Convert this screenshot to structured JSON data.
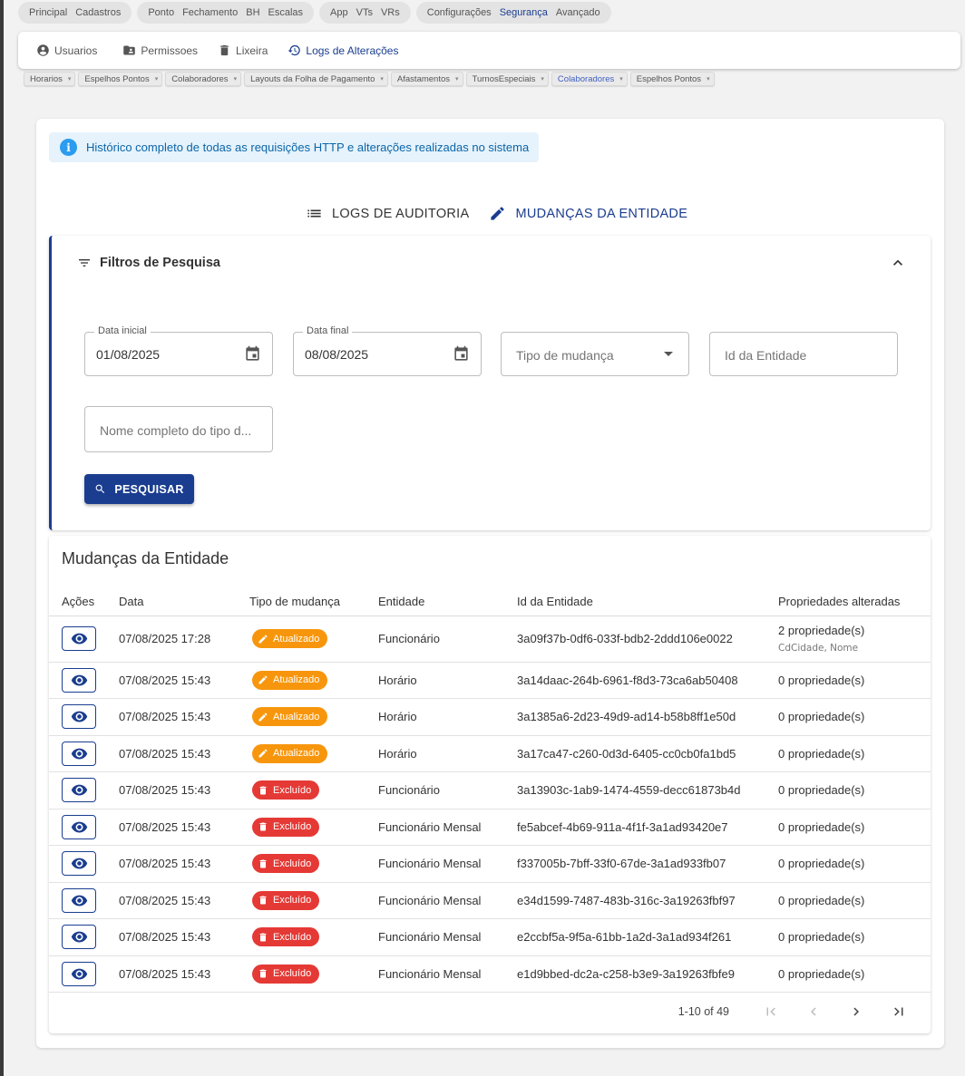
{
  "top_menu": [
    {
      "items": [
        {
          "label": "Principal",
          "active": false
        },
        {
          "label": "Cadastros",
          "active": false
        }
      ]
    },
    {
      "items": [
        {
          "label": "Ponto",
          "active": false
        },
        {
          "label": "Fechamento",
          "active": false
        },
        {
          "label": "BH",
          "active": false
        },
        {
          "label": "Escalas",
          "active": false
        }
      ]
    },
    {
      "items": [
        {
          "label": "App",
          "active": false
        },
        {
          "label": "VTs",
          "active": false
        },
        {
          "label": "VRs",
          "active": false
        }
      ]
    },
    {
      "items": [
        {
          "label": "Configurações",
          "active": false
        },
        {
          "label": "Segurança",
          "active": true
        },
        {
          "label": "Avançado",
          "active": false
        }
      ]
    }
  ],
  "subnav": {
    "usuarios": "Usuarios",
    "permissoes": "Permissoes",
    "lixeira": "Lixeira",
    "logs": "Logs de Alterações"
  },
  "open_tabs": [
    {
      "label": "Horarios",
      "active": false
    },
    {
      "label": "Espelhos Pontos",
      "active": false
    },
    {
      "label": "Colaboradores",
      "active": false
    },
    {
      "label": "Layouts da Folha de Pagamento",
      "active": false
    },
    {
      "label": "Afastamentos",
      "active": false
    },
    {
      "label": "TurnosEspeciais",
      "active": false
    },
    {
      "label": "Colaboradores",
      "active": true
    },
    {
      "label": "Espelhos Pontos",
      "active": false
    }
  ],
  "info_text": "Histórico completo de todas as requisições HTTP e alterações realizadas no sistema",
  "tabs": {
    "audit": "LOGS DE AUDITORIA",
    "entity": "MUDANÇAS DA ENTIDADE"
  },
  "filters": {
    "title": "Filtros de Pesquisa",
    "date_start_label": "Data inicial",
    "date_start_value": "01/08/2025",
    "date_end_label": "Data final",
    "date_end_value": "08/08/2025",
    "change_type_placeholder": "Tipo de mudança",
    "entity_id_placeholder": "Id da Entidade",
    "type_name_placeholder": "Nome completo do tipo d...",
    "search_button": "PESQUISAR"
  },
  "table": {
    "title": "Mudanças da Entidade",
    "headers": [
      "Ações",
      "Data",
      "Tipo de mudança",
      "Entidade",
      "Id da Entidade",
      "Propriedades alteradas"
    ],
    "rows": [
      {
        "date": "07/08/2025 17:28",
        "type": "Atualizado",
        "kind": "upd",
        "entity": "Funcionário",
        "id": "3a09f37b-0df6-033f-bdb2-2ddd106e0022",
        "props": "2 propriedade(s)",
        "props_detail": "CdCidade, Nome"
      },
      {
        "date": "07/08/2025 15:43",
        "type": "Atualizado",
        "kind": "upd",
        "entity": "Horário",
        "id": "3a14daac-264b-6961-f8d3-73ca6ab50408",
        "props": "0 propriedade(s)",
        "props_detail": ""
      },
      {
        "date": "07/08/2025 15:43",
        "type": "Atualizado",
        "kind": "upd",
        "entity": "Horário",
        "id": "3a1385a6-2d23-49d9-ad14-b58b8ff1e50d",
        "props": "0 propriedade(s)",
        "props_detail": ""
      },
      {
        "date": "07/08/2025 15:43",
        "type": "Atualizado",
        "kind": "upd",
        "entity": "Horário",
        "id": "3a17ca47-c260-0d3d-6405-cc0cb0fa1bd5",
        "props": "0 propriedade(s)",
        "props_detail": ""
      },
      {
        "date": "07/08/2025 15:43",
        "type": "Excluído",
        "kind": "del",
        "entity": "Funcionário",
        "id": "3a13903c-1ab9-1474-4559-decc61873b4d",
        "props": "0 propriedade(s)",
        "props_detail": ""
      },
      {
        "date": "07/08/2025 15:43",
        "type": "Excluído",
        "kind": "del",
        "entity": "Funcionário Mensal",
        "id": "fe5abcef-4b69-911a-4f1f-3a1ad93420e7",
        "props": "0 propriedade(s)",
        "props_detail": ""
      },
      {
        "date": "07/08/2025 15:43",
        "type": "Excluído",
        "kind": "del",
        "entity": "Funcionário Mensal",
        "id": "f337005b-7bff-33f0-67de-3a1ad933fb07",
        "props": "0 propriedade(s)",
        "props_detail": ""
      },
      {
        "date": "07/08/2025 15:43",
        "type": "Excluído",
        "kind": "del",
        "entity": "Funcionário Mensal",
        "id": "e34d1599-7487-483b-316c-3a19263fbf97",
        "props": "0 propriedade(s)",
        "props_detail": ""
      },
      {
        "date": "07/08/2025 15:43",
        "type": "Excluído",
        "kind": "del",
        "entity": "Funcionário Mensal",
        "id": "e2ccbf5a-9f5a-61bb-1a2d-3a1ad934f261",
        "props": "0 propriedade(s)",
        "props_detail": ""
      },
      {
        "date": "07/08/2025 15:43",
        "type": "Excluído",
        "kind": "del",
        "entity": "Funcionário Mensal",
        "id": "e1d9bbed-dc2a-c258-b3e9-3a19263fbfe9",
        "props": "0 propriedade(s)",
        "props_detail": ""
      }
    ],
    "pagination": "1-10 of 49"
  },
  "colors": {
    "primary": "#1a3d8f",
    "updated": "#f7960c",
    "deleted": "#e53935",
    "info_bg": "#e6f3fc",
    "info_text": "#0b65a8"
  }
}
